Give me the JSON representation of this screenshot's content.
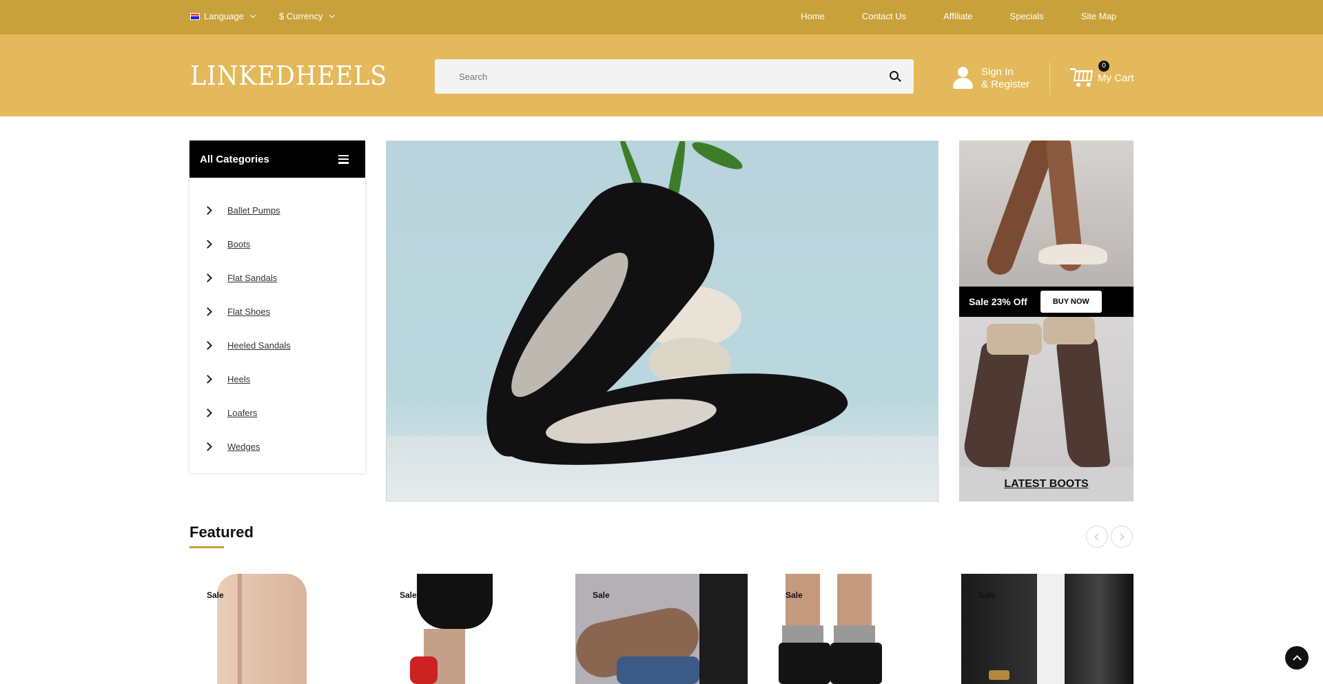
{
  "topbar": {
    "language_label": "Language",
    "currency_label": "$ Currency",
    "nav": [
      "Home",
      "Contact Us",
      "Affiliate",
      "Specials",
      "Site Map"
    ]
  },
  "header": {
    "logo": "LINKEDHEELS",
    "search_placeholder": "Search",
    "sign_in": "Sign In",
    "register": "& Register",
    "cart_count": "0",
    "cart_label": "My Cart"
  },
  "categories": {
    "title": "All Categories",
    "items": [
      "Ballet Pumps",
      "Boots",
      "Flat Sandals",
      "Flat Shoes",
      "Heeled Sandals",
      "Heels",
      "Loafers",
      "Wedges"
    ]
  },
  "side_banner": {
    "sale_text": "Sale 23% Off",
    "buy_now": "BUY NOW",
    "caption": "LATEST BOOTS"
  },
  "featured": {
    "title": "Featured",
    "products": [
      {
        "badge": "Sale"
      },
      {
        "badge": "Sale"
      },
      {
        "badge": "Sale"
      },
      {
        "badge": "Sale"
      },
      {
        "badge": "Sale"
      }
    ]
  },
  "colors": {
    "topbar": "#c9a13b",
    "header": "#e3b95b",
    "accent": "#c9a13b",
    "dark": "#000000"
  },
  "icons": [
    "flag-icon",
    "chevron-down-icon",
    "search-icon",
    "user-icon",
    "cart-icon",
    "menu-icon",
    "chevron-right-icon",
    "arrow-up-icon"
  ]
}
